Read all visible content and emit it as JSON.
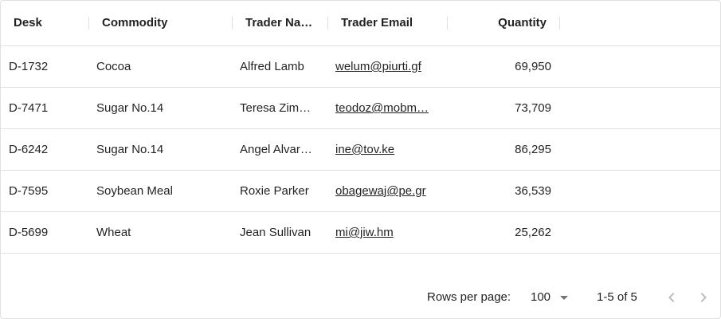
{
  "columns": {
    "desk": "Desk",
    "commodity": "Commodity",
    "trader_name": "Trader Na…",
    "trader_email": "Trader Email",
    "quantity": "Quantity"
  },
  "rows": [
    {
      "desk": "D-1732",
      "commodity": "Cocoa",
      "trader_name": "Alfred Lamb",
      "trader_email": "welum@piurti.gf",
      "quantity": "69,950"
    },
    {
      "desk": "D-7471",
      "commodity": "Sugar No.14",
      "trader_name": "Teresa Zim…",
      "trader_email": "teodoz@mobm…",
      "quantity": "73,709"
    },
    {
      "desk": "D-6242",
      "commodity": "Sugar No.14",
      "trader_name": "Angel Alvar…",
      "trader_email": "ine@tov.ke",
      "quantity": "86,295"
    },
    {
      "desk": "D-7595",
      "commodity": "Soybean Meal",
      "trader_name": "Roxie Parker",
      "trader_email": "obagewaj@pe.gr",
      "quantity": "36,539"
    },
    {
      "desk": "D-5699",
      "commodity": "Wheat",
      "trader_name": "Jean Sullivan",
      "trader_email": "mi@jiw.hm",
      "quantity": "25,262"
    }
  ],
  "pagination": {
    "rows_per_page_label": "Rows per page:",
    "rows_per_page_value": "100",
    "range_text": "1-5 of 5",
    "prev_icon": "chevron-left-icon",
    "next_icon": "chevron-right-icon"
  },
  "colors": {
    "border": "#e0e0e0",
    "text": "#212121",
    "icon_disabled": "#bdbdbd"
  }
}
